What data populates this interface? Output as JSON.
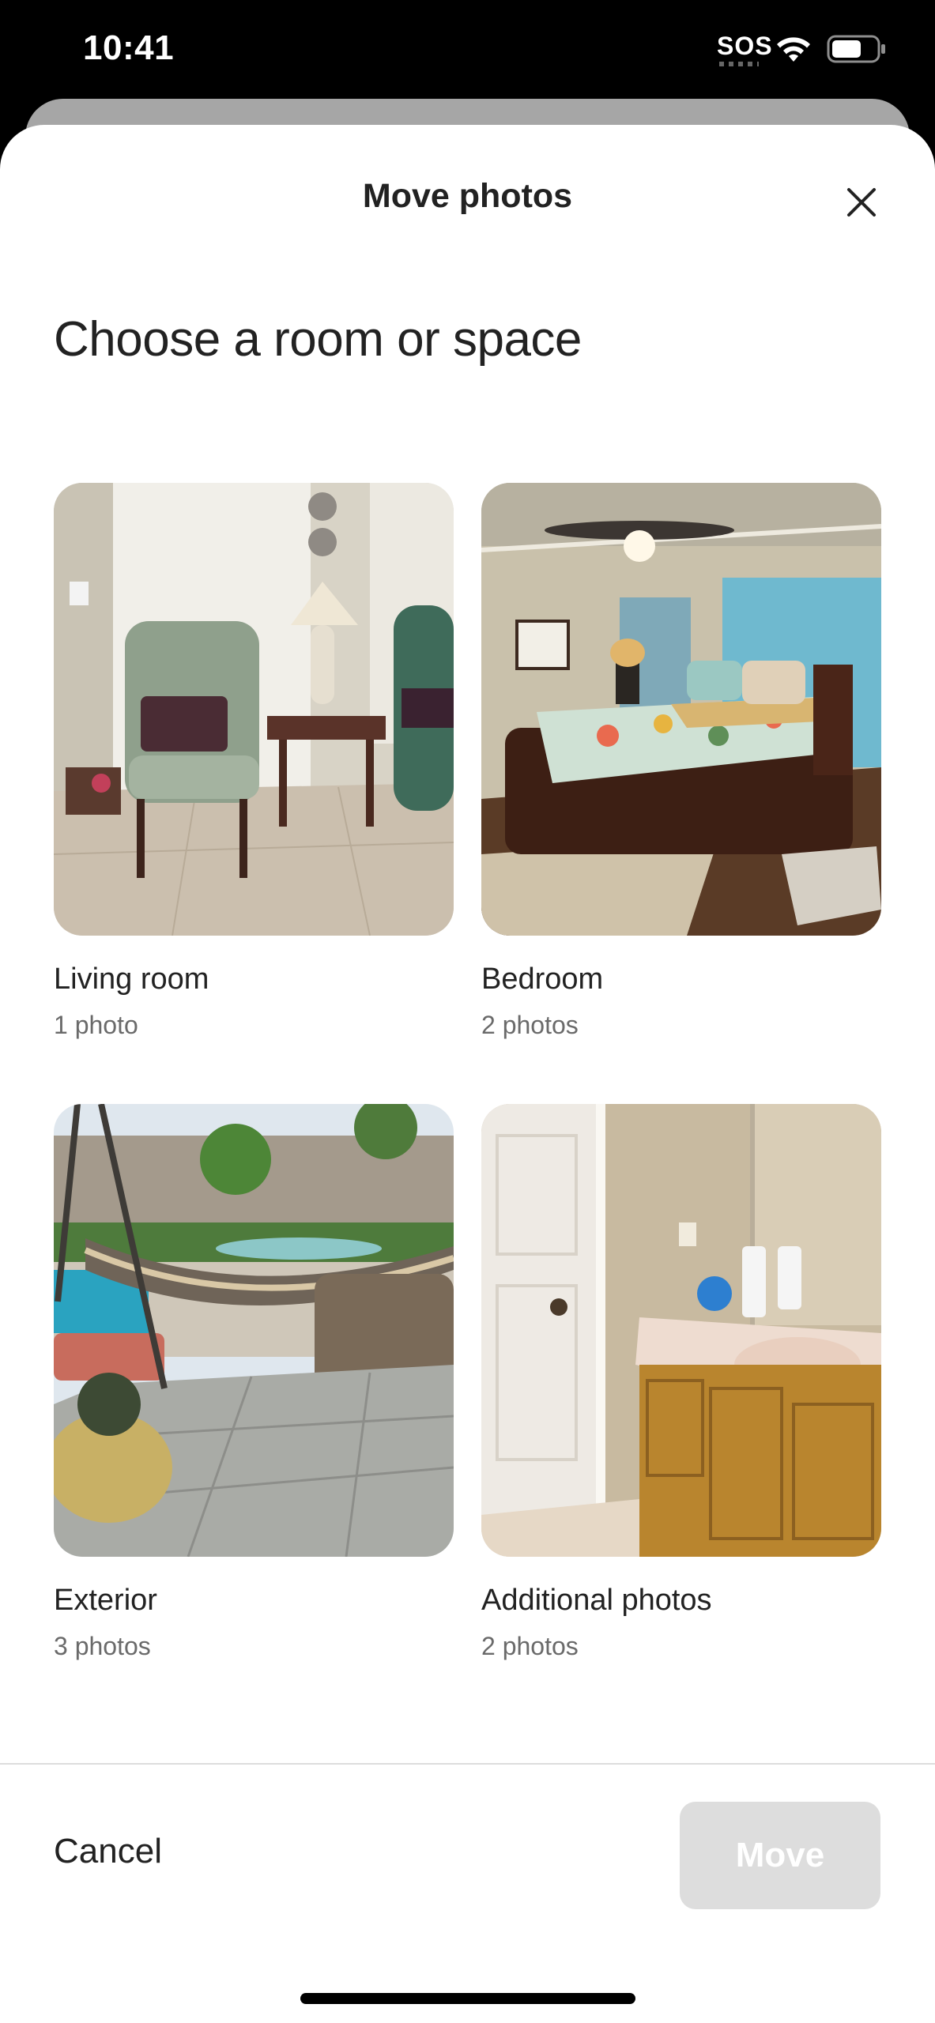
{
  "status_bar": {
    "time": "10:41",
    "sos": "SOS",
    "icons": [
      "wifi-icon",
      "battery-icon"
    ]
  },
  "sheet": {
    "title": "Move photos",
    "close_icon": "close-icon",
    "heading": "Choose a room or space"
  },
  "rooms": [
    {
      "name": "Living room",
      "count": "1 photo"
    },
    {
      "name": "Bedroom",
      "count": "2 photos"
    },
    {
      "name": "Exterior",
      "count": "3 photos"
    },
    {
      "name": "Additional photos",
      "count": "2 photos"
    }
  ],
  "footer": {
    "cancel_label": "Cancel",
    "move_label": "Move"
  },
  "colors": {
    "text_primary": "#222222",
    "text_secondary": "#6a6a6a",
    "disabled_button": "#dddddd"
  }
}
